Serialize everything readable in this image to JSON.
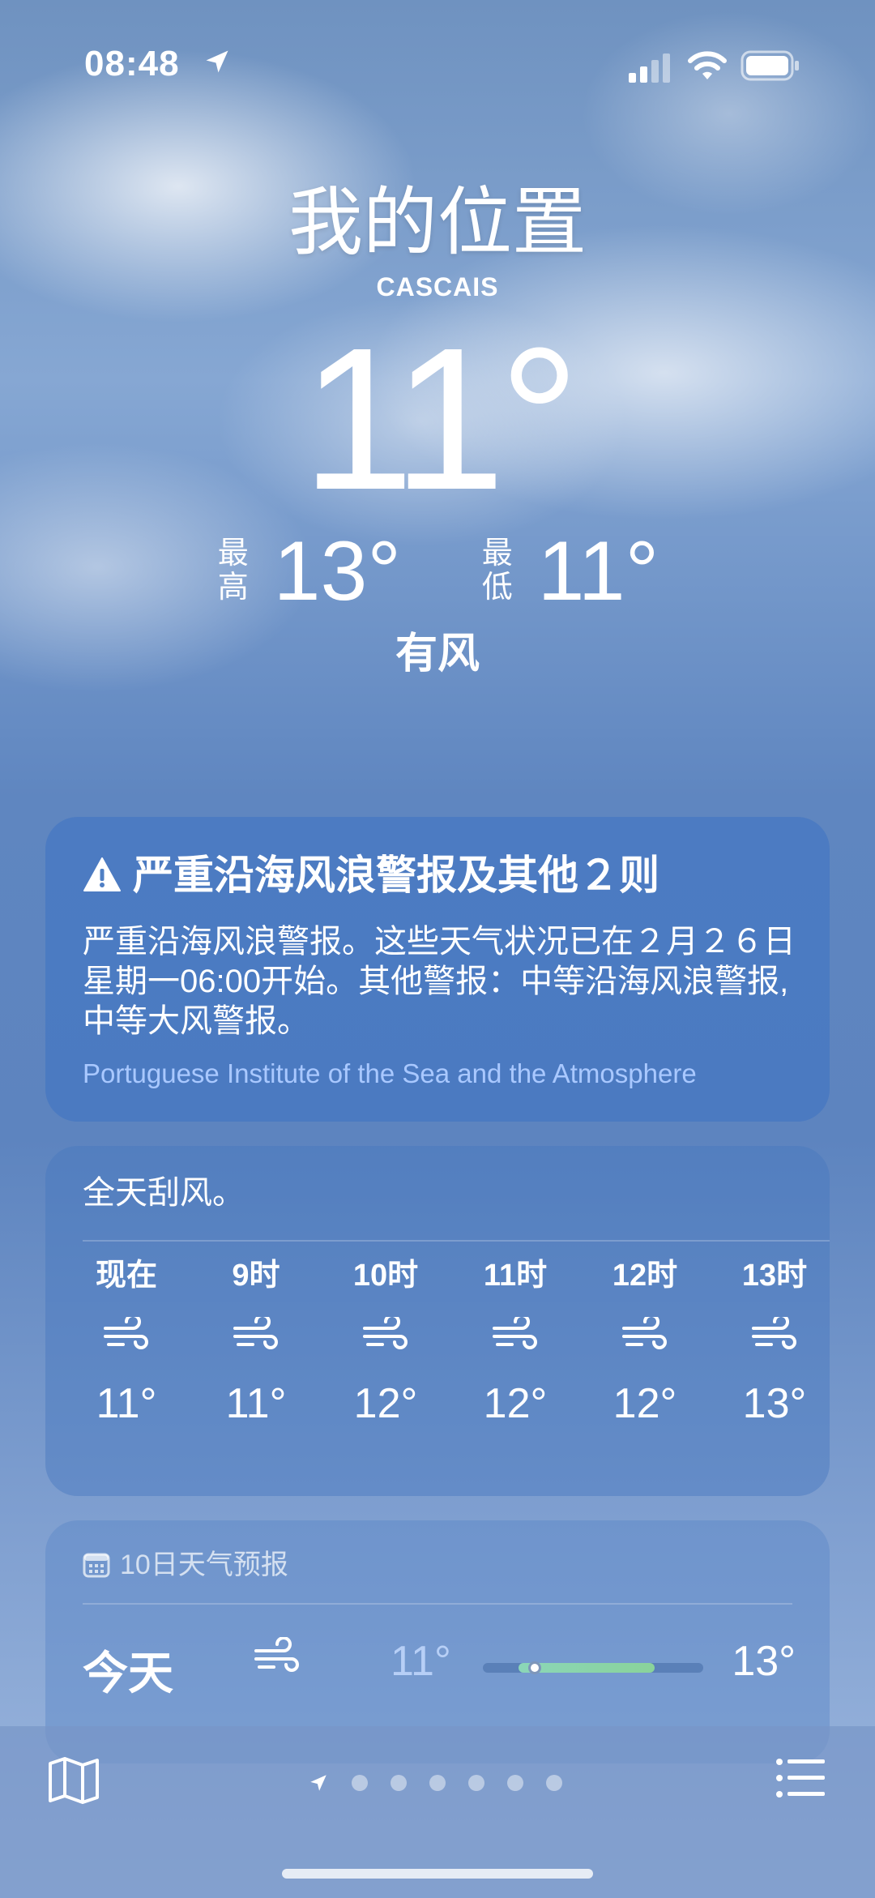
{
  "status_bar": {
    "time": "08:48"
  },
  "location": {
    "title": "我的位置",
    "subtitle": "CASCAIS"
  },
  "current": {
    "temp": "11°",
    "high_label": "最高",
    "high": "13°",
    "low_label": "最低",
    "low": "11°",
    "condition": "有风"
  },
  "alert": {
    "title": "严重沿海风浪警报及其他２则",
    "body": "严重沿海风浪警报。这些天气状况已在２月２６日星期一06:00开始。其他警报：中等沿海风浪警报, 中等大风警报。",
    "source": "Portuguese Institute of the Sea and the Atmosphere"
  },
  "hourly": {
    "note": "全天刮风。",
    "hours": [
      {
        "label": "现在",
        "icon": "wind-icon",
        "temp": "11°"
      },
      {
        "label": "9时",
        "icon": "wind-icon",
        "temp": "11°"
      },
      {
        "label": "10时",
        "icon": "wind-icon",
        "temp": "12°"
      },
      {
        "label": "11时",
        "icon": "wind-icon",
        "temp": "12°"
      },
      {
        "label": "12时",
        "icon": "wind-icon",
        "temp": "12°"
      },
      {
        "label": "13时",
        "icon": "wind-icon",
        "temp": "13°"
      }
    ]
  },
  "daily": {
    "header": "10日天气预报",
    "days": [
      {
        "label": "今天",
        "icon": "wind-icon",
        "low": "11°",
        "high": "13°"
      }
    ]
  },
  "colors": {
    "bar_fill": "#8ad39a",
    "source_link": "#a9c8ff"
  }
}
